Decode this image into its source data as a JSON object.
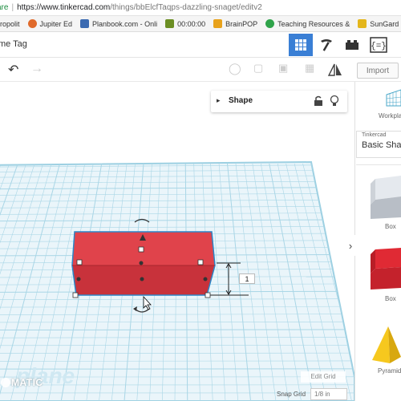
{
  "browser": {
    "secure_label": "are",
    "url_host": "https://www.tinkercad.com",
    "url_path": "/things/bbElcfTaqps-dazzling-snaget/editv2"
  },
  "bookmarks": [
    {
      "label": "ropolit",
      "color": "#c77d2e"
    },
    {
      "label": "Jupiter Ed",
      "color": "#e06a2b"
    },
    {
      "label": "Planbook.com - Onli",
      "color": "#3b6ab1"
    },
    {
      "label": "00:00:00",
      "color": "#6b8e23"
    },
    {
      "label": "BrainPOP",
      "color": "#e8a21b"
    },
    {
      "label": "Teaching Resources &",
      "color": "#2fa34a"
    },
    {
      "label": "SunGard P",
      "color": "#e4b61b"
    }
  ],
  "header": {
    "design_name": "me Tag",
    "icons": [
      "grid-view-icon",
      "build-icon",
      "bricks-icon",
      "code-blocks-icon"
    ]
  },
  "toolbar": {
    "undo_icon": "undo-icon",
    "redo_icon": "redo-icon",
    "import_label": "Import"
  },
  "shape_panel": {
    "title": "Shape"
  },
  "right_panel": {
    "workplane_label": "Workpla",
    "library_small": "Tinkercad",
    "library_big": "Basic Shap",
    "shapes": [
      {
        "label": "Box",
        "color": "#d8dde3"
      },
      {
        "label": "Box",
        "color": "#d9202b"
      },
      {
        "label": "Pyramid",
        "color": "#f1c21b"
      }
    ]
  },
  "workspace": {
    "plane_watermark": "plane",
    "logo": "MATIC",
    "edit_grid_label": "Edit Grid",
    "snap_grid_label": "Snap Grid",
    "snap_grid_value": "1/8 in",
    "height_dimension": "1",
    "box_color": "#d9363e",
    "grid_color": "#8fc8dc"
  }
}
